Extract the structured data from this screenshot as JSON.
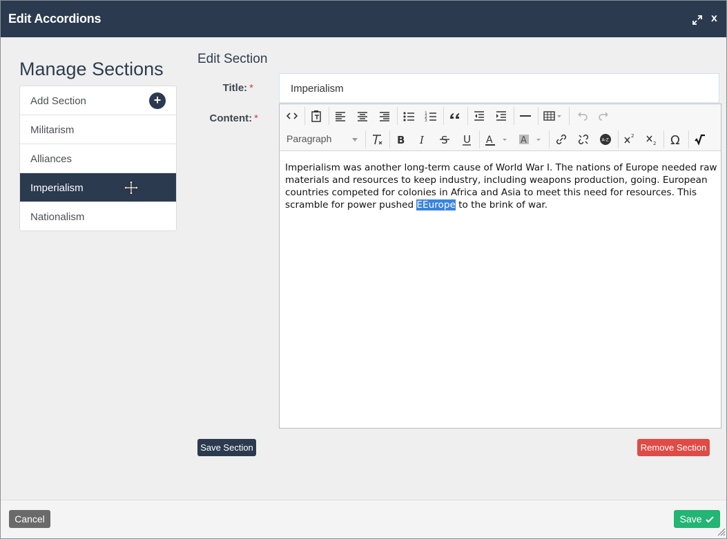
{
  "dialog": {
    "title": "Edit Accordions",
    "close_label": "x"
  },
  "sidebar": {
    "title": "Manage Sections",
    "items": [
      {
        "label": "Add Section"
      },
      {
        "label": "Militarism"
      },
      {
        "label": "Alliances"
      },
      {
        "label": "Imperialism"
      },
      {
        "label": "Nationalism"
      }
    ],
    "add_label": "+"
  },
  "editor": {
    "heading": "Edit Section",
    "title_label": "Title:",
    "content_label": "Content:",
    "required_mark": "*",
    "title_value": "Imperialism",
    "paragraph_select": "Paragraph",
    "content_before": "Imperialism was another long-term cause of World War I. The nations of Europe needed raw materials and resources to keep industry, including weapons production, going. European countries competed for colonies in Africa and Asia to meet this need for resources. This scramble for power pushed ",
    "content_selected": "EEurope",
    "content_after": " to the brink of war."
  },
  "buttons": {
    "save_section": "Save Section",
    "remove_section": "Remove Section",
    "cancel": "Cancel",
    "save": "Save"
  },
  "colors": {
    "titlebar": "#2b3a4e",
    "accent_dark": "#2b3a4e",
    "danger": "#e04b45",
    "success": "#22b573",
    "selection": "#3b82e0"
  }
}
